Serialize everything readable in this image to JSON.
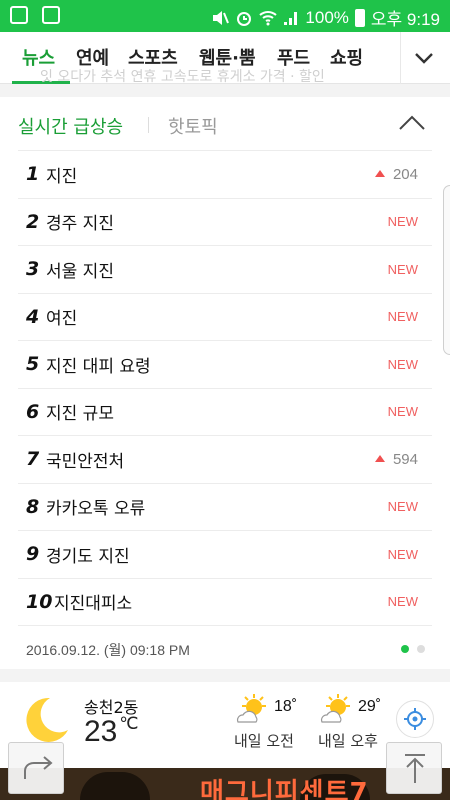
{
  "status_bar": {
    "battery": "100%",
    "time": "오후 9:19"
  },
  "tabs": [
    {
      "label": "뉴스"
    },
    {
      "label": "연예"
    },
    {
      "label": "스포츠"
    },
    {
      "label": "웹툰·뿜"
    },
    {
      "label": "푸드"
    },
    {
      "label": "쇼핑"
    }
  ],
  "ghost_text": "잇 오다가 추석 연휴 고속도로 휴게소 가격 · 할인",
  "panel": {
    "tab_active": "실시간 급상승",
    "tab_other": "핫토픽",
    "items": [
      {
        "rank": "1",
        "keyword": "지진",
        "change": "204",
        "is_new": false
      },
      {
        "rank": "2",
        "keyword": "경주 지진",
        "change": "NEW",
        "is_new": true
      },
      {
        "rank": "3",
        "keyword": "서울 지진",
        "change": "NEW",
        "is_new": true
      },
      {
        "rank": "4",
        "keyword": "여진",
        "change": "NEW",
        "is_new": true
      },
      {
        "rank": "5",
        "keyword": "지진 대피 요령",
        "change": "NEW",
        "is_new": true
      },
      {
        "rank": "6",
        "keyword": "지진 규모",
        "change": "NEW",
        "is_new": true
      },
      {
        "rank": "7",
        "keyword": "국민안전처",
        "change": "594",
        "is_new": false
      },
      {
        "rank": "8",
        "keyword": "카카오톡 오류",
        "change": "NEW",
        "is_new": true
      },
      {
        "rank": "9",
        "keyword": "경기도 지진",
        "change": "NEW",
        "is_new": true
      },
      {
        "rank": "10",
        "keyword": "지진대피소",
        "change": "NEW",
        "is_new": true
      }
    ],
    "timestamp": "2016.09.12. (월) 09:18 PM"
  },
  "weather": {
    "location": "송천2동",
    "temp": "23",
    "unit": "℃",
    "forecasts": [
      {
        "temp": "18˚",
        "label": "내일 오전"
      },
      {
        "temp": "29˚",
        "label": "내일 오후"
      }
    ]
  },
  "ad": {
    "title": "매그니피센트7"
  },
  "colors": {
    "brand_green": "#1fc34a",
    "active_text_green": "#1a9e36",
    "new_red": "#f06060"
  }
}
